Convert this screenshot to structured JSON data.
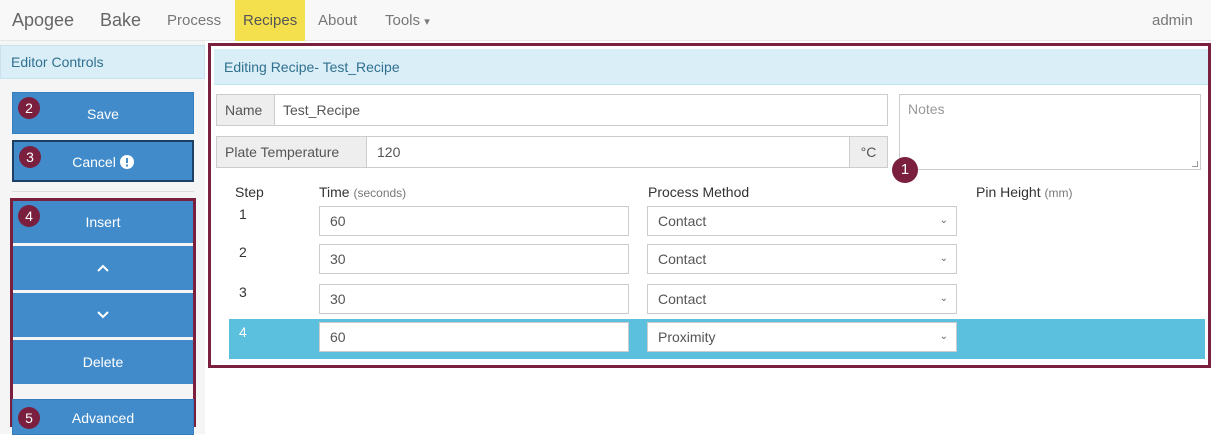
{
  "navbar": {
    "brand_primary": "Apogee",
    "brand_secondary": "Bake",
    "items": [
      {
        "label": "Process"
      },
      {
        "label": "Recipes"
      },
      {
        "label": "About"
      },
      {
        "label": "Tools"
      }
    ],
    "tools_caret": "▾",
    "user": "admin",
    "active_color": "#f4e04d"
  },
  "sidebar": {
    "header": "Editor Controls",
    "save": {
      "label": "Save",
      "badge": "2"
    },
    "cancel": {
      "label": "Cancel",
      "badge": "3",
      "icon": "exclamation-circle-icon"
    },
    "group_badge": "4",
    "insert_label": "Insert",
    "up_glyph": "^",
    "down_glyph": "v",
    "delete_label": "Delete",
    "advanced": {
      "label": "Advanced",
      "badge": "5"
    }
  },
  "editor": {
    "title": "Editing Recipe- Test_Recipe",
    "callout": "1",
    "name_label": "Name",
    "name_value": "Test_Recipe",
    "notes_placeholder": "Notes",
    "plate_label": "Plate Temperature",
    "plate_value": "120",
    "plate_unit": "°C",
    "columns": {
      "step": "Step",
      "time": "Time",
      "time_unit": "(seconds)",
      "method": "Process Method",
      "pin": "Pin Height",
      "pin_unit": "(mm)"
    },
    "rows": [
      {
        "step": "1",
        "time": "60",
        "method": "Contact"
      },
      {
        "step": "2",
        "time": "30",
        "method": "Contact"
      },
      {
        "step": "3",
        "time": "30",
        "method": "Contact"
      },
      {
        "step": "4",
        "time": "60",
        "method": "Proximity"
      }
    ],
    "selected_row_color": "#5bc0de",
    "highlight_frame_color": "#7a1f3d"
  }
}
